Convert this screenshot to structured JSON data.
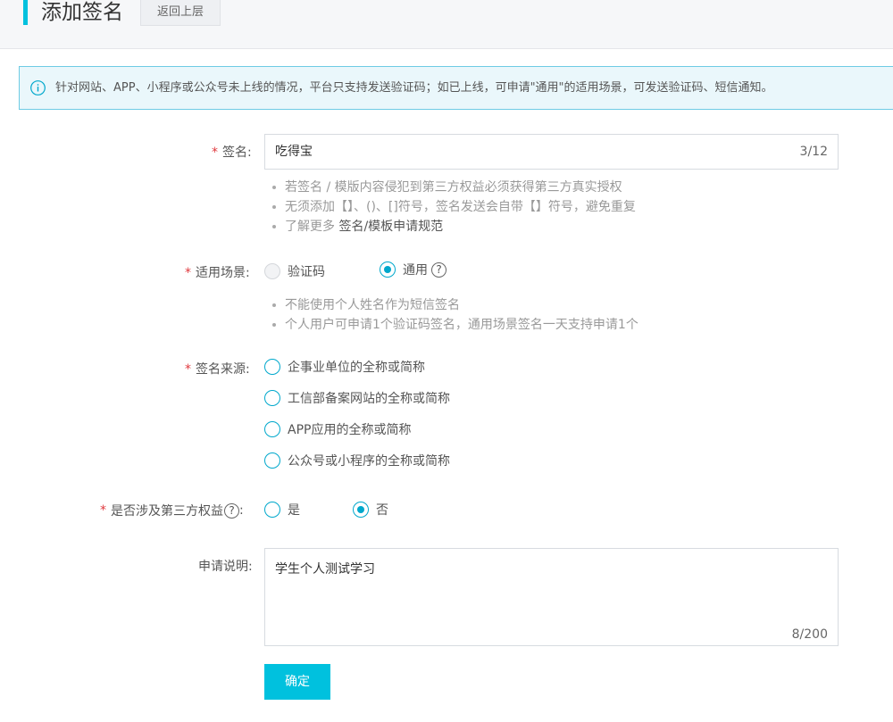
{
  "header": {
    "title": "添加签名",
    "back_label": "返回上层"
  },
  "notice": {
    "icon": "info-icon",
    "text": "针对网站、APP、小程序或公众号未上线的情况，平台只支持发送验证码；如已上线，可申请\"通用\"的适用场景，可发送验证码、短信通知。"
  },
  "signature": {
    "required_mark": "*",
    "label": "签名:",
    "value": "吃得宝",
    "count": "3/12",
    "hints": [
      "若签名 / 模版内容侵犯到第三方权益必须获得第三方真实授权",
      "无须添加【】、()、[]符号，签名发送会自带【】符号，避免重复"
    ],
    "learn_more_prefix": "了解更多",
    "learn_more_link": "签名/模板申请规范"
  },
  "scene": {
    "required_mark": "*",
    "label": "适用场景:",
    "options": [
      {
        "label": "验证码",
        "state": "disabled"
      },
      {
        "label": "通用",
        "state": "checked"
      }
    ],
    "help_icon": "?",
    "hints": [
      "不能使用个人姓名作为短信签名",
      "个人用户可申请1个验证码签名，通用场景签名一天支持申请1个"
    ]
  },
  "source": {
    "required_mark": "*",
    "label": "签名来源:",
    "options": [
      {
        "label": "企事业单位的全称或简称"
      },
      {
        "label": "工信部备案网站的全称或简称"
      },
      {
        "label": "APP应用的全称或简称"
      },
      {
        "label": "公众号或小程序的全称或简称"
      }
    ]
  },
  "third_party": {
    "required_mark": "*",
    "label": "是否涉及第三方权益",
    "help_icon": "?",
    "colon": ":",
    "options": [
      {
        "label": "是",
        "state": "unchecked"
      },
      {
        "label": "否",
        "state": "checked"
      }
    ]
  },
  "description": {
    "label": "申请说明:",
    "value": "学生个人测试学习",
    "count": "8/200"
  },
  "submit_label": "确定",
  "colors": {
    "accent": "#00c1de",
    "required": "#e0393e",
    "notice_bg": "#eaf7fb",
    "notice_border": "#6ecbe4"
  }
}
